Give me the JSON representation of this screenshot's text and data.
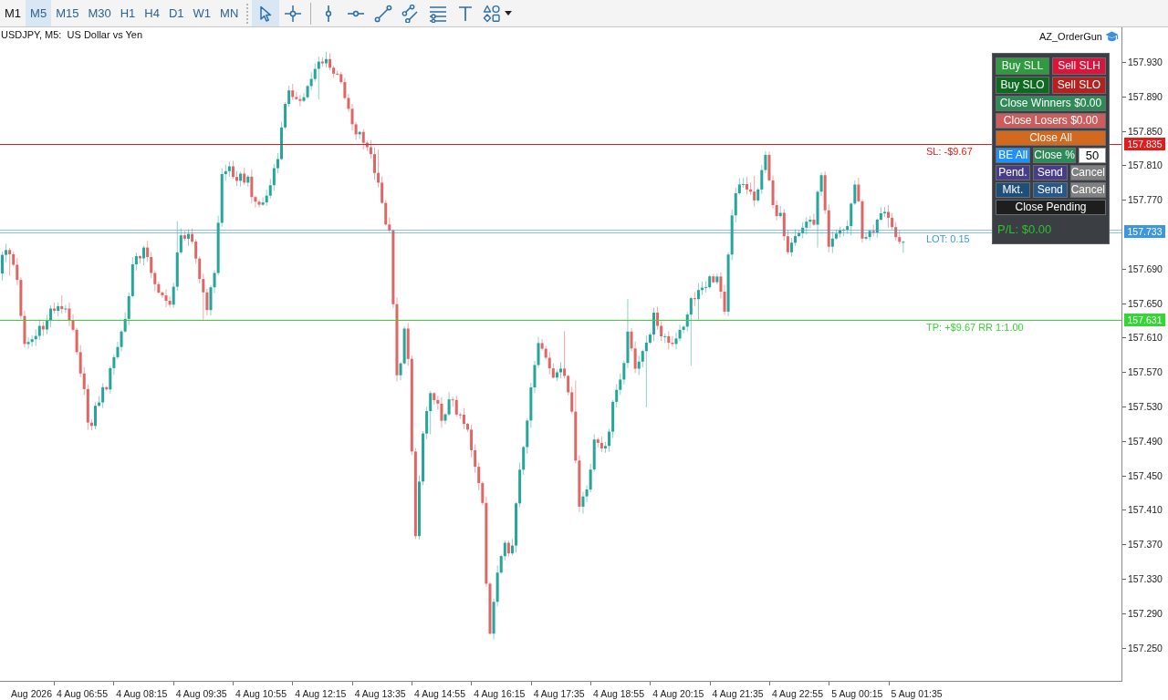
{
  "toolbar": {
    "timeframes": [
      {
        "label": "M1",
        "selected": false
      },
      {
        "label": "M5",
        "selected": true
      },
      {
        "label": "M15",
        "selected": false
      },
      {
        "label": "M30",
        "selected": false
      },
      {
        "label": "H1",
        "selected": false
      },
      {
        "label": "H4",
        "selected": false
      },
      {
        "label": "D1",
        "selected": false
      },
      {
        "label": "W1",
        "selected": false
      },
      {
        "label": "MN",
        "selected": false
      }
    ],
    "tools": [
      {
        "kind": "cursor",
        "selected": true
      },
      {
        "kind": "crosshair",
        "selected": false
      },
      {
        "kind": "vline",
        "selected": false
      },
      {
        "kind": "hline",
        "selected": false
      },
      {
        "kind": "trendline",
        "selected": false
      },
      {
        "kind": "channel",
        "selected": false
      },
      {
        "kind": "levels",
        "selected": false
      },
      {
        "kind": "text",
        "selected": false
      },
      {
        "kind": "shapes",
        "selected": false
      }
    ]
  },
  "chart": {
    "title": "USDJPY, M5:  US Dollar vs Yen",
    "expert": "AZ_OrderGun"
  },
  "order_panel": {
    "rows": [
      [
        {
          "kind": "button",
          "label": "Buy SLL",
          "color": "#2e9b3e"
        },
        {
          "kind": "button",
          "label": "Sell SLH",
          "color": "#dc143c"
        }
      ],
      [
        {
          "kind": "button",
          "label": "Buy SLO",
          "color": "#0d6b1f"
        },
        {
          "kind": "button",
          "label": "Sell SLO",
          "color": "#b5211f"
        }
      ],
      [
        {
          "kind": "button",
          "label": "Close Winners $0.00",
          "color": "#2e8b57"
        }
      ],
      [
        {
          "kind": "button",
          "label": "Close Losers $0.00",
          "color": "#cd5c5c"
        }
      ],
      [
        {
          "kind": "button",
          "label": "Close All",
          "color": "#d2691e"
        }
      ],
      [
        {
          "kind": "button",
          "label": "BE All",
          "color": "#1e90ff"
        },
        {
          "kind": "button",
          "label": "Close %",
          "color": "#2e8b57"
        },
        {
          "kind": "input",
          "value": "50"
        }
      ],
      [
        {
          "kind": "button",
          "label": "Pend.",
          "color": "#483d8b"
        },
        {
          "kind": "button",
          "label": "Send",
          "color": "#483d8b"
        },
        {
          "kind": "button",
          "label": "Cancel",
          "color": "#808080"
        }
      ],
      [
        {
          "kind": "button",
          "label": "Mkt.",
          "color": "#1f4e79"
        },
        {
          "kind": "button",
          "label": "Send",
          "color": "#28588a"
        },
        {
          "kind": "button",
          "label": "Cancel",
          "color": "#808080"
        }
      ],
      [
        {
          "kind": "button",
          "label": "Close Pending",
          "color": "#1e1e1e"
        }
      ]
    ],
    "pl": "P/L: $0.00"
  },
  "levels": [
    {
      "kind": "sl",
      "label": "SL: -$9.67",
      "price_tag": "157.835",
      "color": "#e31b1b"
    },
    {
      "kind": "lot",
      "label": "LOT: 0.15",
      "price_tag": "157.733",
      "color": "#3d97e0"
    },
    {
      "kind": "tp",
      "label": "TP: +$9.67 RR 1:1.00",
      "price_tag": "157.631",
      "color": "#33d633"
    }
  ],
  "price_axis": {
    "labels": [
      "157.930",
      "157.890",
      "157.850",
      "157.810",
      "157.770",
      "157.690",
      "157.650",
      "157.610",
      "157.570",
      "157.530",
      "157.490",
      "157.450",
      "157.410",
      "157.370",
      "157.330",
      "157.290",
      "157.250"
    ]
  },
  "time_axis": {
    "labels": [
      "Aug 2026",
      "4 Aug 06:55",
      "4 Aug 08:15",
      "4 Aug 09:35",
      "4 Aug 10:55",
      "4 Aug 12:15",
      "4 Aug 13:35",
      "4 Aug 14:55",
      "4 Aug 16:15",
      "4 Aug 17:35",
      "4 Aug 18:55",
      "4 Aug 20:15",
      "4 Aug 21:35",
      "4 Aug 22:55",
      "5 Aug 00:15",
      "5 Aug 01:35"
    ]
  }
}
